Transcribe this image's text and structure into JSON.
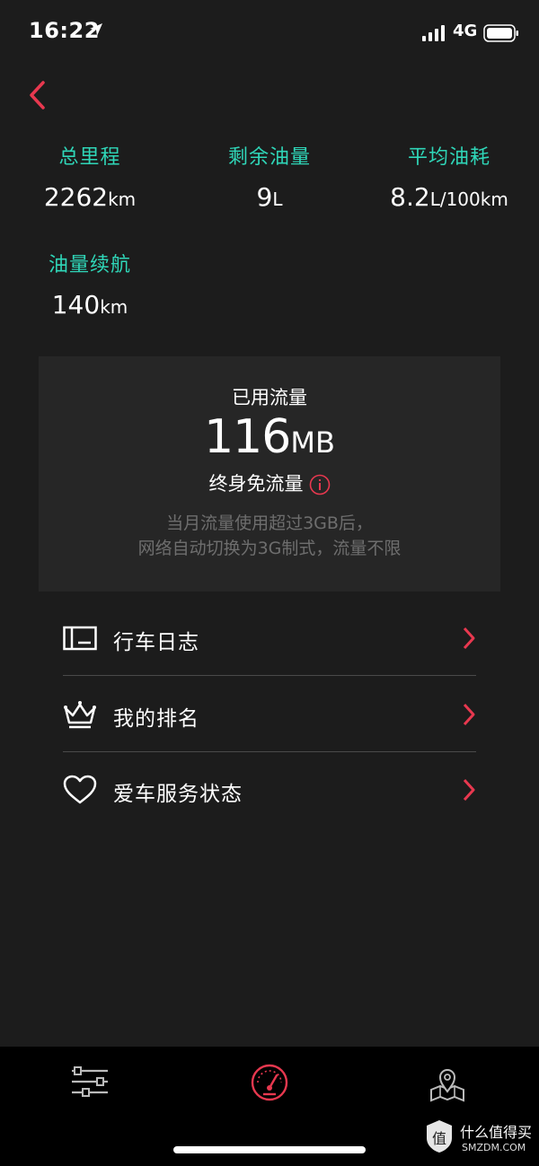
{
  "status_bar": {
    "time": "16:22",
    "network": "4G"
  },
  "stats": [
    {
      "label": "总里程",
      "value": "2262",
      "unit": "km"
    },
    {
      "label": "剩余油量",
      "value": "9",
      "unit": "L"
    },
    {
      "label": "平均油耗",
      "value": "8.2",
      "unit": "L/100km"
    },
    {
      "label": "油量续航",
      "value": "140",
      "unit": "km"
    }
  ],
  "data_card": {
    "title": "已用流量",
    "amount": "116",
    "amount_unit": "MB",
    "plan": "终身免流量",
    "note_line1": "当月流量使用超过3GB后，",
    "note_line2": "网络自动切换为3G制式，流量不限"
  },
  "menu": [
    {
      "label": "行车日志",
      "icon": "log-icon"
    },
    {
      "label": "我的排名",
      "icon": "crown-icon"
    },
    {
      "label": "爱车服务状态",
      "icon": "heart-icon"
    }
  ],
  "tab_bar": {
    "tabs": [
      "settings-sliders-icon",
      "speedometer-icon",
      "map-location-icon"
    ],
    "active_index": 1
  },
  "watermark": {
    "cn": "什么值得买",
    "en": "SMZDM.COM",
    "badge": "值"
  },
  "colors": {
    "accent": "#e8384f",
    "label": "#2fd6b8",
    "background": "#1c1c1c",
    "card": "#262626"
  }
}
